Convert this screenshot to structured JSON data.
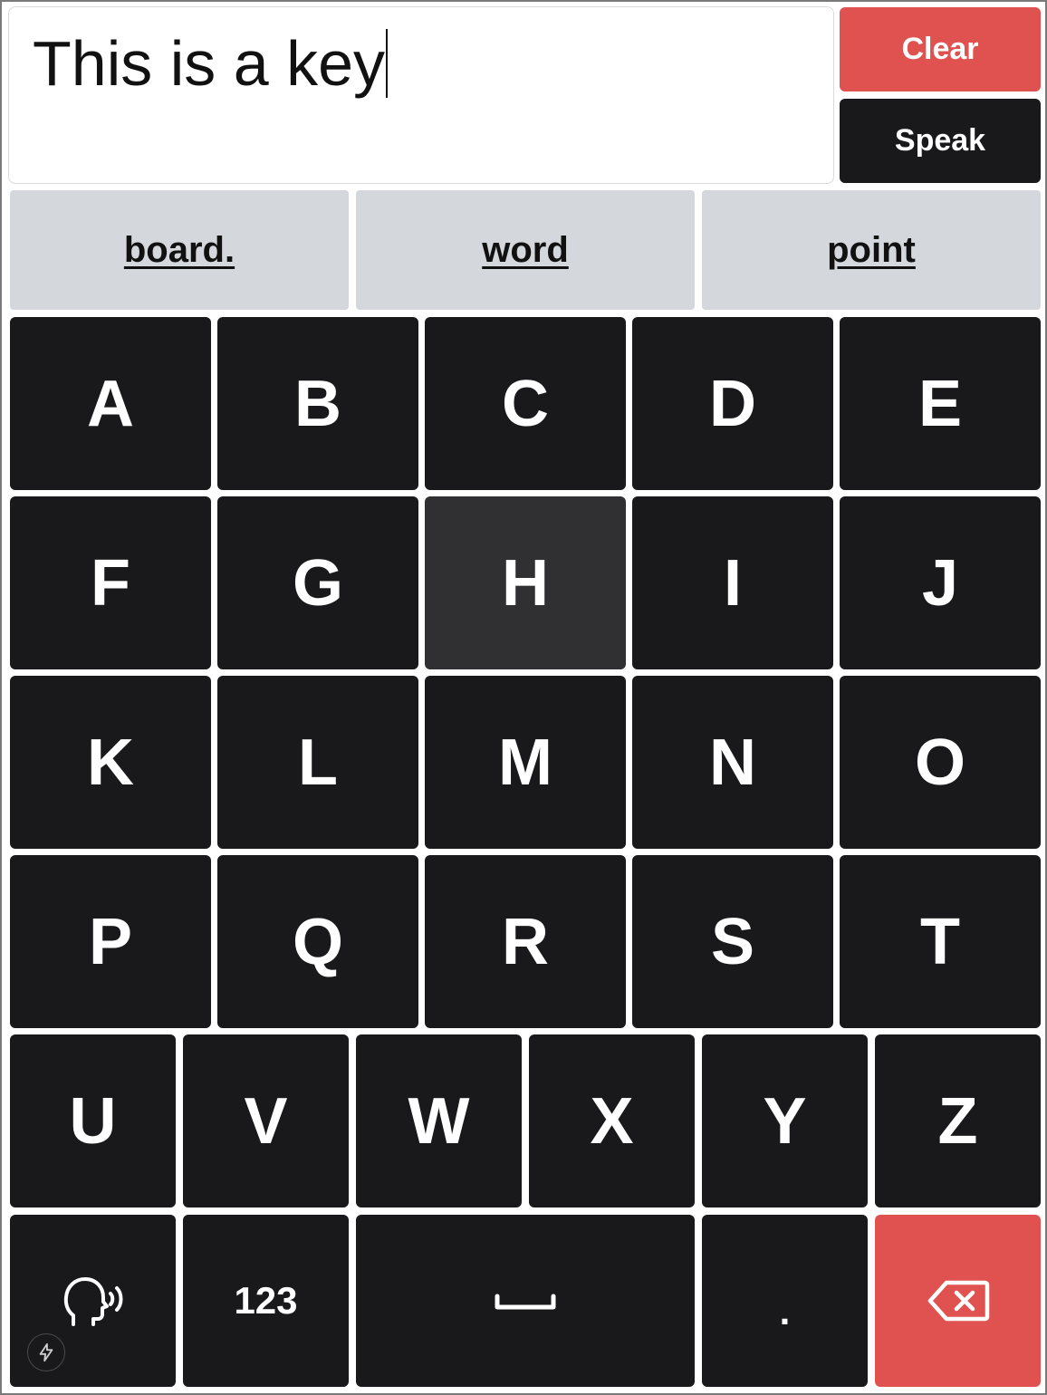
{
  "text_input": {
    "value": "This is a key"
  },
  "actions": {
    "clear_label": "Clear",
    "speak_label": "Speak"
  },
  "suggestions": [
    "board.",
    "word",
    "point"
  ],
  "keys": {
    "row1": [
      "A",
      "B",
      "C",
      "D",
      "E"
    ],
    "row2": [
      "F",
      "G",
      "H",
      "I",
      "J"
    ],
    "row3": [
      "K",
      "L",
      "M",
      "N",
      "O"
    ],
    "row4": [
      "P",
      "Q",
      "R",
      "S",
      "T"
    ],
    "row5": [
      "U",
      "V",
      "W",
      "X",
      "Y",
      "Z"
    ],
    "numbers_label": "123",
    "period_label": "."
  },
  "icons": {
    "speech": "speaking-head-icon",
    "space": "space-bar-icon",
    "delete": "backspace-icon",
    "bolt": "lightning-bolt-icon"
  },
  "colors": {
    "accent_red": "#e05250",
    "key_dark": "#19191b",
    "key_hover": "#303032",
    "suggestion_bg": "#d4d7db"
  }
}
